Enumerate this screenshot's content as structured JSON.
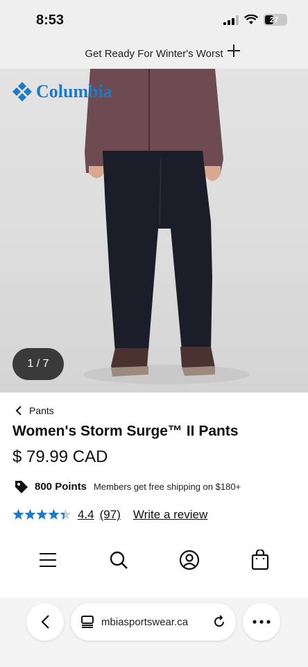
{
  "status_bar": {
    "time": "8:53",
    "battery": "27"
  },
  "promo": {
    "text": "Get Ready For Winter's Worst"
  },
  "brand": {
    "name": "Columbia",
    "color": "#1c7bc7"
  },
  "gallery": {
    "counter": "1 / 7"
  },
  "product": {
    "breadcrumb": "Pants",
    "title": "Women's Storm Surge™ II Pants",
    "price": "$ 79.99 CAD",
    "points": "800 Points",
    "points_note": "Members get free shipping on $180+",
    "rating": "4.4",
    "rating_value": 4.4,
    "review_count": "(97)",
    "write_review": "Write a review",
    "star_color": "#1c7bc7"
  },
  "toolbar": {
    "icons": [
      "menu-icon",
      "search-icon",
      "account-icon",
      "cart-icon"
    ]
  },
  "browser": {
    "url": "mbiasportswear.ca"
  }
}
